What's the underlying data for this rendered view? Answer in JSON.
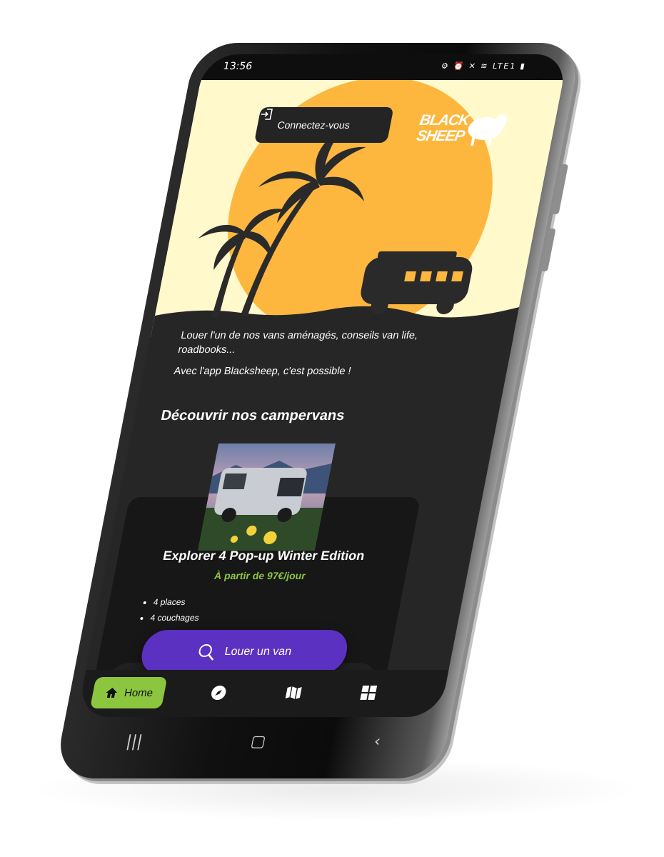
{
  "status_bar": {
    "time": "13:56",
    "icons": "⚙ ⏰ ✕ ≋ LTE1 ▮"
  },
  "header": {
    "login_label": "Connectez-vous",
    "logo_line1": "BLACK",
    "logo_line2": "SHEEP"
  },
  "intro": {
    "line1": "Louer l'un de nos vans aménagés, conseils van life, roadbooks...",
    "line2": "Avec l'app Blacksheep, c'est possible !"
  },
  "section": {
    "title": "Découvrir nos campervans"
  },
  "van_card": {
    "title": "Explorer 4 Pop-up Winter Edition",
    "price": "À partir de 97€/jour",
    "features": [
      "4 places",
      "4 couchages"
    ]
  },
  "rent_button": {
    "label": "Louer un van"
  },
  "tabbar": {
    "home_label": "Home"
  },
  "colors": {
    "accent_green": "#8cc63f",
    "accent_purple": "#5b31c2",
    "sun": "#fdb73e",
    "sky": "#fff9cc"
  }
}
